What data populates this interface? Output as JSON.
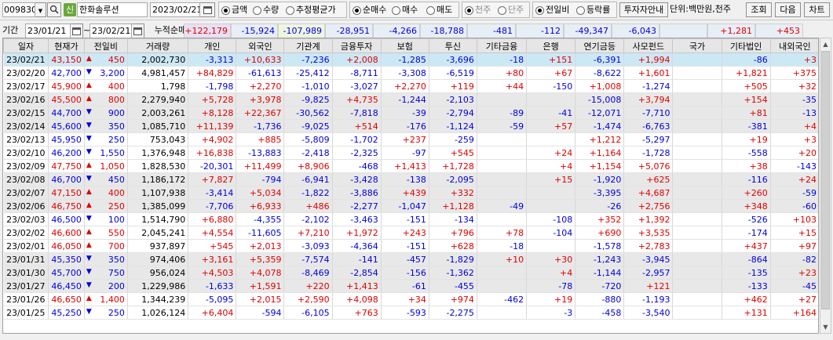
{
  "toolbar": {
    "code": "009830",
    "search_icon": "search-icon",
    "tag": "신",
    "name": "한화솔루션",
    "date": "2023/02/21",
    "radios1": [
      {
        "label": "금액",
        "on": true
      },
      {
        "label": "수량",
        "on": false
      },
      {
        "label": "추정평균가",
        "on": false
      }
    ],
    "radios2": [
      {
        "label": "순매수",
        "on": true
      },
      {
        "label": "매수",
        "on": false
      },
      {
        "label": "매도",
        "on": false
      }
    ],
    "radios3": [
      {
        "label": "천주",
        "on": true
      },
      {
        "label": "단주",
        "on": false
      }
    ],
    "radios4": [
      {
        "label": "전일비",
        "on": true
      },
      {
        "label": "등락률",
        "on": false
      }
    ],
    "investor_info": "투자자안내",
    "unit": "단위:백만원,천주",
    "query": "조회",
    "next": "다음",
    "chart": "차트"
  },
  "period": {
    "label": "기간",
    "from": "23/01/21",
    "tilde": "~",
    "to": "23/02/21",
    "cum_label": "누적순매수",
    "sums": [
      "+122,179",
      "-15,924",
      "-107,989",
      "-28,951",
      "-4,266",
      "-18,788",
      "-481",
      "-112",
      "-49,347",
      "-6,043",
      "",
      "+1,281",
      "+453"
    ]
  },
  "columns": [
    "일자",
    "현재가",
    "전일비",
    "거래량",
    "개인",
    "외국인",
    "기관계",
    "금융투자",
    "보험",
    "투신",
    "기타금융",
    "은행",
    "연기금등",
    "사모펀드",
    "국가",
    "기타법인",
    "내외국인"
  ],
  "colors": {
    "up": "#e00000",
    "down": "#0000e0",
    "selected_row": "#cde8f5",
    "alt_row": "#e8e8e8"
  },
  "rows": [
    [
      "23/02/21",
      "43,150",
      "up",
      "450",
      "2,002,730",
      "-3,313",
      "+10,633",
      "-7,236",
      "+2,008",
      "-1,285",
      "-3,696",
      "-18",
      "+151",
      "-6,391",
      "+1,994",
      "",
      "-86",
      "+3"
    ],
    [
      "23/02/20",
      "42,700",
      "dn",
      "3,200",
      "4,981,457",
      "+84,829",
      "-61,613",
      "-25,412",
      "-8,711",
      "-3,308",
      "-6,519",
      "+80",
      "+67",
      "-8,622",
      "+1,601",
      "",
      "+1,821",
      "+375"
    ],
    [
      "23/02/17",
      "45,900",
      "up",
      "400",
      "1,798",
      "-1,798",
      "+2,270",
      "-1,010",
      "-3,027",
      "+2,270",
      "+119",
      "+44",
      "-150",
      "+1,008",
      "-1,274",
      "",
      "+505",
      "+32"
    ],
    [
      "23/02/16",
      "45,500",
      "up",
      "800",
      "2,279,940",
      "+5,728",
      "+3,978",
      "-9,825",
      "+4,735",
      "-1,244",
      "-2,103",
      "",
      "",
      "-15,008",
      "+3,794",
      "",
      "+154",
      "-35"
    ],
    [
      "23/02/15",
      "44,700",
      "dn",
      "900",
      "2,003,261",
      "+8,128",
      "+22,367",
      "-30,562",
      "-7,818",
      "-39",
      "-2,794",
      "-89",
      "-41",
      "-12,071",
      "-7,710",
      "",
      "+81",
      "-13"
    ],
    [
      "23/02/14",
      "45,600",
      "dn",
      "350",
      "1,085,710",
      "+11,139",
      "-1,736",
      "-9,025",
      "+514",
      "-176",
      "-1,124",
      "-59",
      "+57",
      "-1,474",
      "-6,763",
      "",
      "-381",
      "+4"
    ],
    [
      "23/02/13",
      "45,950",
      "dn",
      "250",
      "753,043",
      "+4,902",
      "+885",
      "-5,809",
      "-1,702",
      "+237",
      "-259",
      "",
      "",
      "+1,212",
      "-5,297",
      "",
      "+19",
      "+3"
    ],
    [
      "23/02/10",
      "46,200",
      "dn",
      "1,550",
      "1,376,948",
      "+16,838",
      "-13,883",
      "-2,418",
      "-2,325",
      "-97",
      "+545",
      "",
      "+24",
      "+1,164",
      "-1,728",
      "",
      "-558",
      "+20"
    ],
    [
      "23/02/09",
      "47,750",
      "up",
      "1,050",
      "1,828,530",
      "-20,301",
      "+11,499",
      "+8,906",
      "-468",
      "+1,413",
      "+1,728",
      "",
      "+4",
      "+1,154",
      "+5,076",
      "",
      "+38",
      "-143"
    ],
    [
      "23/02/08",
      "46,700",
      "dn",
      "450",
      "1,186,172",
      "+7,827",
      "-794",
      "-6,941",
      "-3,428",
      "-138",
      "-2,095",
      "",
      "+15",
      "-1,920",
      "+625",
      "",
      "-116",
      "+24"
    ],
    [
      "23/02/07",
      "47,150",
      "up",
      "400",
      "1,107,938",
      "-3,414",
      "+5,034",
      "-1,822",
      "-3,886",
      "+439",
      "+332",
      "",
      "",
      "-3,395",
      "+4,687",
      "",
      "+260",
      "-59"
    ],
    [
      "23/02/06",
      "46,750",
      "up",
      "250",
      "1,385,099",
      "-7,706",
      "+6,933",
      "+486",
      "-2,277",
      "-1,047",
      "+1,128",
      "-49",
      "",
      "-26",
      "+2,756",
      "",
      "+348",
      "-60"
    ],
    [
      "23/02/03",
      "46,500",
      "dn",
      "100",
      "1,514,790",
      "+6,880",
      "-4,355",
      "-2,102",
      "-3,463",
      "-151",
      "-134",
      "",
      "-108",
      "+352",
      "+1,392",
      "",
      "-526",
      "+103"
    ],
    [
      "23/02/02",
      "46,600",
      "up",
      "550",
      "2,045,241",
      "+4,554",
      "-11,605",
      "+7,210",
      "+1,972",
      "+243",
      "+796",
      "+78",
      "-104",
      "+690",
      "+3,535",
      "",
      "-174",
      "+15"
    ],
    [
      "23/02/01",
      "46,050",
      "up",
      "700",
      "937,897",
      "+545",
      "+2,013",
      "-3,093",
      "-4,364",
      "-151",
      "+628",
      "-18",
      "",
      "-1,578",
      "+2,783",
      "",
      "+437",
      "+97"
    ],
    [
      "23/01/31",
      "45,350",
      "dn",
      "350",
      "974,406",
      "+3,161",
      "+5,359",
      "-7,574",
      "-141",
      "-457",
      "-1,829",
      "+10",
      "+30",
      "-1,243",
      "-3,945",
      "",
      "-864",
      "-82"
    ],
    [
      "23/01/30",
      "45,700",
      "dn",
      "750",
      "956,024",
      "+4,503",
      "+4,078",
      "-8,469",
      "-2,854",
      "-156",
      "-1,362",
      "",
      "+4",
      "-1,144",
      "-2,957",
      "",
      "-135",
      "+23"
    ],
    [
      "23/01/27",
      "46,450",
      "dn",
      "200",
      "1,229,986",
      "-1,633",
      "+1,591",
      "+220",
      "+1,413",
      "-61",
      "-455",
      "",
      "-78",
      "-720",
      "+121",
      "",
      "-133",
      "-45"
    ],
    [
      "23/01/26",
      "46,650",
      "up",
      "1,400",
      "1,344,239",
      "-5,095",
      "+2,015",
      "+2,590",
      "+4,098",
      "+34",
      "+974",
      "-462",
      "+19",
      "-880",
      "-1,193",
      "",
      "+462",
      "+27"
    ],
    [
      "23/01/25",
      "45,250",
      "dn",
      "250",
      "1,026,124",
      "+6,404",
      "-594",
      "-6,105",
      "+763",
      "-593",
      "-2,275",
      "",
      "-3",
      "-458",
      "-3,540",
      "",
      "+131",
      "+164"
    ]
  ]
}
